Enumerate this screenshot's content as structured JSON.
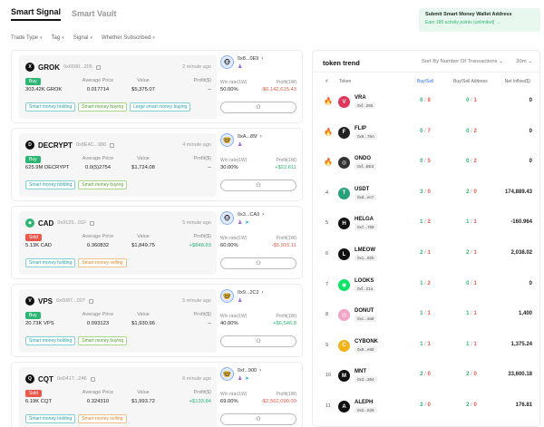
{
  "tabs": [
    {
      "label": "Smart Signal",
      "active": true
    },
    {
      "label": "Smart Vault",
      "active": false
    }
  ],
  "banner": {
    "title": "Submit Smart Money Wallet Address",
    "subtitle": "Earn 180 activity points (unlimited) →"
  },
  "filters": [
    {
      "label": "Trade Type"
    },
    {
      "label": "Tag"
    },
    {
      "label": "Signal"
    },
    {
      "label": "Whether Subscribed"
    }
  ],
  "headers": {
    "amount": "",
    "avg_price": "Average Price",
    "value": "Value",
    "profit": "Profit($)",
    "win_rate": "Win rate(1W)",
    "profit_1w": "Profit(1W)"
  },
  "follow_label": "⚇",
  "signals": [
    {
      "symbol": "GROK",
      "icon_letter": "X",
      "icon_color": "#111111",
      "address": "0x6590...205",
      "time": "2 minute ago",
      "side": "Buy",
      "amount": "303.42K GROK",
      "avg_price": "0.017714",
      "value": "$5,375.07",
      "profit": "--",
      "profit_sign": "",
      "tags": [
        {
          "label": "Smart money holding",
          "color": "teal"
        },
        {
          "label": "Smart money buying",
          "color": "green"
        },
        {
          "label": "Large smart money buying",
          "color": "teal"
        }
      ],
      "wallet": {
        "address": "0x8...0E9",
        "emoji": "🐵",
        "win_rate": "50.00%",
        "profit": "-$6,142,615.43",
        "profit_sign": "neg"
      }
    },
    {
      "symbol": "DECRYPT",
      "icon_letter": "D",
      "icon_color": "#111111",
      "address": "0x8E4C...980",
      "time": "4 minute ago",
      "side": "Buy",
      "amount": "625.9M DECRYPT",
      "avg_price": "0.0(5)2754",
      "value": "$1,724.08",
      "profit": "--",
      "profit_sign": "",
      "tags": [
        {
          "label": "Smart money holding",
          "color": "teal"
        },
        {
          "label": "Smart money buying",
          "color": "green"
        }
      ],
      "wallet": {
        "address": "0xA...85f",
        "emoji": "🤓",
        "win_rate": "30.00%",
        "profit": "+$22,611",
        "profit_sign": "pos"
      }
    },
    {
      "symbol": "CAD",
      "icon_letter": "◆",
      "icon_color": "#2bb673",
      "address": "0x9125...01F",
      "time": "5 minute ago",
      "side": "Sold",
      "amount": "5.13K CAD",
      "avg_price": "0.360832",
      "value": "$1,849.75",
      "profit": "+$848.83",
      "profit_sign": "pos",
      "tags": [
        {
          "label": "Smart money holding",
          "color": "teal"
        },
        {
          "label": "Smart money selling",
          "color": "orange"
        }
      ],
      "wallet": {
        "address": "0x3...CA9",
        "emoji": "🐵",
        "win_rate": "60.00%",
        "profit": "-$5,915.11",
        "profit_sign": "neg"
      }
    },
    {
      "symbol": "VPS",
      "icon_letter": "V",
      "icon_color": "#111111",
      "address": "0x0087...007",
      "time": "5 minute ago",
      "side": "Buy",
      "amount": "20.73K VPS",
      "avg_price": "0.093123",
      "value": "$1,930.96",
      "profit": "--",
      "profit_sign": "",
      "tags": [
        {
          "label": "Smart money holding",
          "color": "teal"
        },
        {
          "label": "Smart money buying",
          "color": "green"
        }
      ],
      "wallet": {
        "address": "0x9...2C2",
        "emoji": "🤓",
        "win_rate": "40.00%",
        "profit": "+$6,546.8",
        "profit_sign": "pos"
      }
    },
    {
      "symbol": "CQT",
      "icon_letter": "Q",
      "icon_color": "#111111",
      "address": "0xD417...246",
      "time": "6 minute ago",
      "side": "Sold",
      "amount": "6.19K CQT",
      "avg_price": "0.324310",
      "value": "$1,993.72",
      "profit": "+$133.84",
      "profit_sign": "pos",
      "tags": [
        {
          "label": "Smart money holding",
          "color": "teal"
        },
        {
          "label": "Smart money selling",
          "color": "orange"
        }
      ],
      "wallet": {
        "address": "0xf...900",
        "emoji": "🤓",
        "win_rate": "69.00%",
        "profit": "-$2,562,090.09",
        "profit_sign": "neg"
      }
    }
  ],
  "trend": {
    "title": "token trend",
    "sort": "Sort By Number Of Transactions ⌄",
    "interval": "30m ⌄",
    "columns": {
      "idx": "#",
      "token": "Token",
      "buy_sell": "Buy/Sell",
      "buy_sell_addr": "Buy/Sell Address",
      "net_inflow": "Net Inflow($)"
    },
    "rows": [
      {
        "idx": "",
        "hot": true,
        "symbol": "VRA",
        "address": "0xf...255",
        "icon_color": "#e0365c",
        "icon_letter": "V",
        "buy": "0",
        "sell": "8",
        "buy_addr": "0",
        "sell_addr": "1",
        "net": "0"
      },
      {
        "idx": "",
        "hot": true,
        "symbol": "FLIP",
        "address": "0x8...78A",
        "icon_color": "#222222",
        "icon_letter": "F",
        "buy": "0",
        "sell": "7",
        "buy_addr": "0",
        "sell_addr": "2",
        "net": "0"
      },
      {
        "idx": "",
        "hot": true,
        "symbol": "ONDO",
        "address": "0xf...BE3",
        "icon_color": "#333333",
        "icon_letter": "◎",
        "buy": "0",
        "sell": "5",
        "buy_addr": "0",
        "sell_addr": "2",
        "net": "0"
      },
      {
        "idx": "4",
        "hot": false,
        "symbol": "USDT",
        "address": "0xd...ec7",
        "icon_color": "#26a17b",
        "icon_letter": "T",
        "buy": "3",
        "sell": "0",
        "buy_addr": "2",
        "sell_addr": "0",
        "net": "174,889.43"
      },
      {
        "idx": "5",
        "hot": false,
        "symbol": "HELGA",
        "address": "0x7...789",
        "icon_color": "#111111",
        "icon_letter": "H",
        "buy": "1",
        "sell": "2",
        "buy_addr": "1",
        "sell_addr": "1",
        "net": "-160.964"
      },
      {
        "idx": "6",
        "hot": false,
        "symbol": "LMEOW",
        "address": "0x1...92b",
        "icon_color": "#111111",
        "icon_letter": "L",
        "buy": "2",
        "sell": "1",
        "buy_addr": "2",
        "sell_addr": "1",
        "net": "2,038.02"
      },
      {
        "idx": "7",
        "hot": false,
        "symbol": "LOOKS",
        "address": "0xf...21a",
        "icon_color": "#0ce466",
        "icon_letter": "◉",
        "buy": "1",
        "sell": "2",
        "buy_addr": "0",
        "sell_addr": "1",
        "net": "0"
      },
      {
        "idx": "8",
        "hot": false,
        "symbol": "DONUT",
        "address": "0xc...4a9",
        "icon_color": "#f3a5c8",
        "icon_letter": "◎",
        "buy": "1",
        "sell": "1",
        "buy_addr": "1",
        "sell_addr": "1",
        "net": "1,400"
      },
      {
        "idx": "9",
        "hot": false,
        "symbol": "CYBONK",
        "address": "0x9...e58",
        "icon_color": "#f2b21a",
        "icon_letter": "C",
        "buy": "1",
        "sell": "1",
        "buy_addr": "1",
        "sell_addr": "1",
        "net": "1,375.24"
      },
      {
        "idx": "10",
        "hot": false,
        "symbol": "MNT",
        "address": "0x3...354",
        "icon_color": "#111111",
        "icon_letter": "M",
        "buy": "2",
        "sell": "0",
        "buy_addr": "2",
        "sell_addr": "0",
        "net": "33,600.18"
      },
      {
        "idx": "11",
        "hot": false,
        "symbol": "ALEPH",
        "address": "0x2...628",
        "icon_color": "#111111",
        "icon_letter": "A",
        "buy": "2",
        "sell": "0",
        "buy_addr": "2",
        "sell_addr": "0",
        "net": "176.81"
      }
    ]
  }
}
